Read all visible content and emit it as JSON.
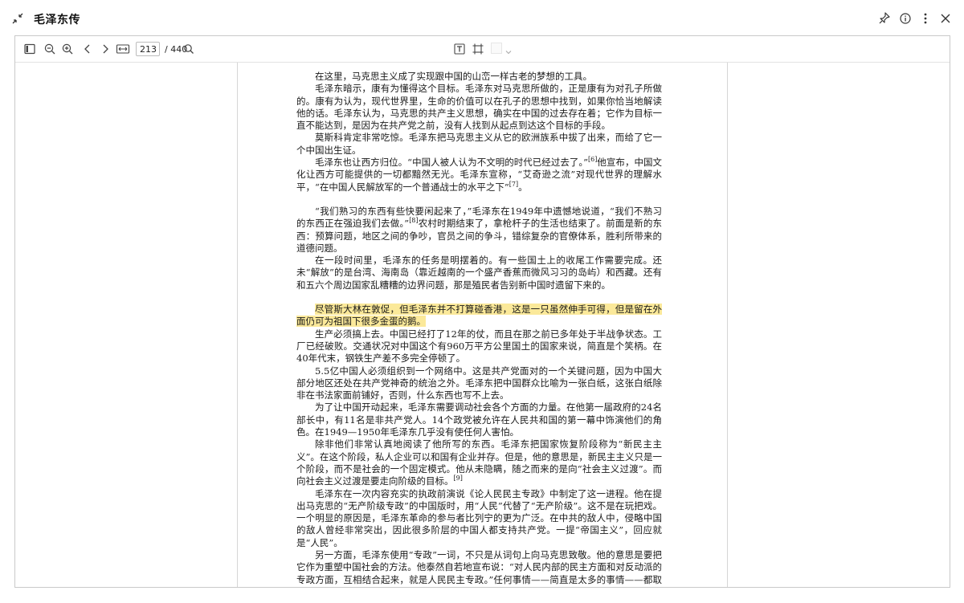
{
  "window": {
    "title": "毛泽东传",
    "icons": {
      "collapse": "collapse-arrows-icon",
      "pin": "pin-icon",
      "info": "info-icon",
      "more": "more-vertical-icon",
      "close": "close-icon"
    }
  },
  "toolbar": {
    "current_page": "213",
    "total_pages": "/ 440",
    "icons": [
      "sidebar-toggle-icon",
      "zoom-out-icon",
      "zoom-in-icon",
      "previous-page-icon",
      "next-page-icon",
      "fit-width-icon",
      "search-icon",
      "text-tool-icon",
      "crop-icon",
      "highlight-color-icon",
      "chevron-down-icon"
    ]
  },
  "document": {
    "paragraphs": [
      {
        "text": "在这里，马克思主义成了实现跟中国的山峦一样古老的梦想的工具。"
      },
      {
        "text": "毛泽东暗示，康有为懂得这个目标。毛泽东对马克思所做的，正是康有为对孔子所做的。康有为认为，现代世界里，生命的价值可以在孔子的思想中找到，如果你恰当地解读他的话。毛泽东认为，马克思的共产主义思想，确实在中国的过去存在着；它作为目标一直不能达到，是因为在共产党之前，没有人找到从起点到达这个目标的手段。"
      },
      {
        "text": "莫斯科肯定非常吃惊。毛泽东把马克思主义从它的欧洲族系中拔了出来，而给了它一个中国出生证。"
      },
      {
        "text": "毛泽东也让西方归位。“中国人被人认为不文明的时代已经过去了。”",
        "ref": "[6]",
        "tail": "他宣布，中国文化让西方可能提供的一切都黯然无光。毛泽东宣称，“艾奇逊之流”对现代世界的理解水平，“在中国人民解放军的一个普通战士的水平之下”",
        "ref2": "[7]",
        "tail2": "。"
      },
      {
        "text": "“我们熟习的东西有些快要闲起来了，”毛泽东在1949年中遗憾地说道，“我们不熟习的东西正在强迫我们去做。”",
        "ref": "[8]",
        "tail": "农村时期结束了，拿枪杆子的生活也结束了。前面是新的东西：预算问题，地区之间的争吵，官员之间的争斗，错综复杂的官僚体系，胜利所带来的道德问题。"
      },
      {
        "text": "在一段时间里，毛泽东的任务是明摆着的。有一些国土上的收尾工作需要完成。还未“解放”的是台湾、海南岛（靠近越南的一个盛产香蕉而微风习习的岛屿）和西藏。还有和五六个周边国家乱糟糟的边界问题，那是殖民者告别新中国时遗留下来的。"
      },
      {
        "text": "尽管斯大林在敦促，但毛泽东并不打算碰香港，这是一只虽然伸手可得，但是留在外面仍可为祖国下很多金蛋的鹅。"
      },
      {
        "text": "生产必须搞上去。中国已经打了12年的仗，而且在那之前已多年处于半战争状态。工厂已经破败。交通状况对中国这个有960万平方公里国土的国家来说，简直是个笑柄。在40年代末，钢铁生产差不多完全停顿了。"
      },
      {
        "text": "5.5亿中国人必须组织到一个网络中。这是共产党面对的一个关键问题，因为中国大部分地区还处在共产党神奇的统治之外。毛泽东把中国群众比喻为一张白纸，这张白纸除非在书法家面前铺好，否则，什么东西也写不上去。"
      },
      {
        "text": "为了让中国开动起来，毛泽东需要调动社会各个方面的力量。在他第一届政府的24名部长中，有11名是非共产党人。14个政党被允许在人民共和国的第一幕中饰演他们的角色。在1949—1950年毛泽东几乎没有使任何人害怕。"
      },
      {
        "text": "除非他们非常认真地阅读了他所写的东西。毛泽东把国家恢复阶段称为“新民主主义”。在这个阶段，私人企业可以和国有企业并存。但是，他的意思是，新民主主义只是一个阶段，而不是社会的一个固定模式。他从未隐瞒，随之而来的是向“社会主义过渡”。而向社会主义过渡是要走向阶级的目标。",
        "ref": "[9]",
        "tail": ""
      },
      {
        "text": "毛泽东在一次内容充实的执政前演说《论人民民主专政》中制定了这一进程。他在提出马克思的“无产阶级专政”的中国版时，用“人民”代替了“无产阶级”。这不是在玩把戏。一个明显的原因是，毛泽东革命的参与者比列宁的更为广泛。在中共的敌人中，侵略中国的敌人曾经非常突出，因此很多阶层的中国人都支持共产党。一提“帝国主义”，回应就是“人民”。"
      },
      {
        "text": "另一方面，毛泽东使用“专政”一词，不只是从词句上向马克思致敬。他的意思是要把它作为重塑中国社会的方法。他泰然自若地宣布说：“对人民内部的民主方面和对反动派的专政方面，互相结合起来，就是人民民主专政。”任何事情——简直是太多的事情——都取决于在变革的时代究竟谁属于“人民”。"
      }
    ]
  }
}
